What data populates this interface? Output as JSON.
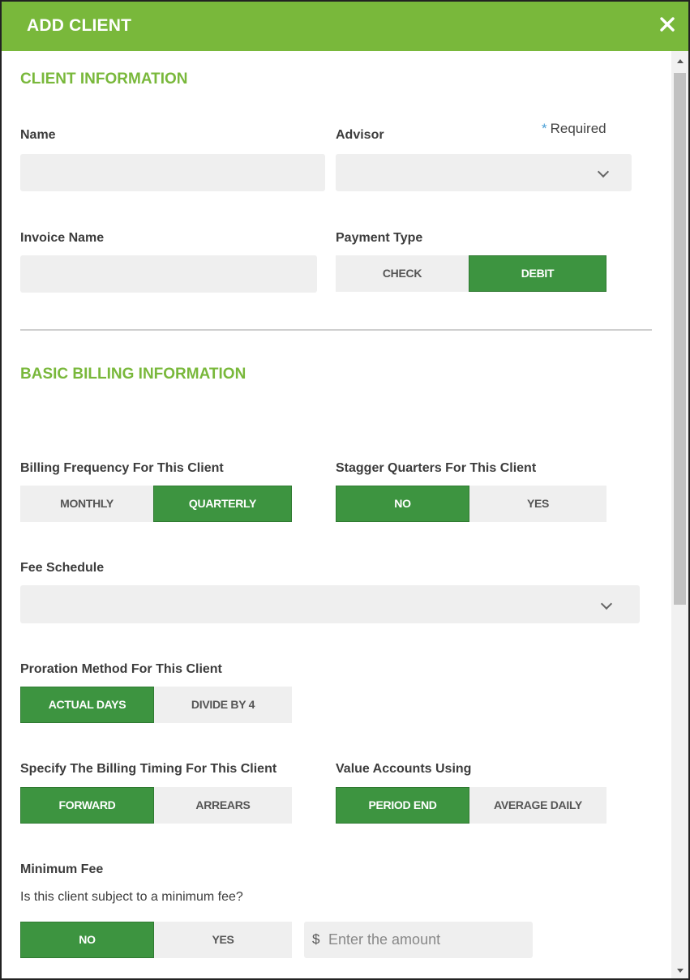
{
  "header": {
    "title": "ADD CLIENT"
  },
  "client_info": {
    "title": "CLIENT INFORMATION",
    "required_label": "Required",
    "name_label": "Name",
    "advisor_label": "Advisor",
    "invoice_name_label": "Invoice Name",
    "payment_type_label": "Payment Type",
    "payment_options": [
      "CHECK",
      "DEBIT"
    ],
    "payment_selected": "DEBIT"
  },
  "billing_info": {
    "title": "BASIC BILLING INFORMATION",
    "frequency_label": "Billing Frequency For This Client",
    "frequency_options": [
      "MONTHLY",
      "QUARTERLY"
    ],
    "frequency_selected": "QUARTERLY",
    "stagger_label": "Stagger Quarters For This Client",
    "stagger_options": [
      "NO",
      "YES"
    ],
    "stagger_selected": "NO",
    "fee_schedule_label": "Fee Schedule",
    "proration_label": "Proration Method For This Client",
    "proration_options": [
      "ACTUAL DAYS",
      "DIVIDE BY 4"
    ],
    "proration_selected": "ACTUAL DAYS",
    "timing_label": "Specify The Billing Timing For This Client",
    "timing_options": [
      "FORWARD",
      "ARREARS"
    ],
    "timing_selected": "FORWARD",
    "value_label": "Value Accounts Using",
    "value_options": [
      "PERIOD END",
      "AVERAGE DAILY"
    ],
    "value_selected": "PERIOD END",
    "min_fee_label": "Minimum Fee",
    "min_fee_question": "Is this client subject to a minimum fee?",
    "min_fee_options": [
      "NO",
      "YES"
    ],
    "min_fee_selected": "NO",
    "amount_currency": "$",
    "amount_placeholder": "Enter the amount"
  },
  "icons": {
    "close": "close-icon",
    "chevron": "chevron-down-icon"
  },
  "colors": {
    "header": "#79b83b",
    "accent_text": "#79b83b",
    "selected": "#3d9440",
    "field_bg": "#efefef"
  }
}
